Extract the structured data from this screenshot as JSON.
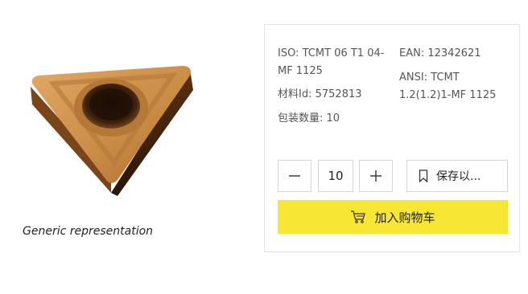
{
  "product": {
    "image_alt_icon": "triangular-insert-image",
    "caption": "Generic representation"
  },
  "specs": {
    "iso_label": "ISO:",
    "iso_value": "TCMT 06 T1 04-MF 1125",
    "material_label": "材料Id:",
    "material_value": "5752813",
    "pack_label": "包装数量:",
    "pack_value": "10",
    "ean_label": "EAN:",
    "ean_value": "12342621",
    "ansi_label": "ANSI:",
    "ansi_value": "TCMT 1.2(1.2)1-MF 1125"
  },
  "controls": {
    "quantity": "10",
    "save_label": "保存以...",
    "cart_label": "加入购物车",
    "minus_icon": "minus-icon",
    "plus_icon": "plus-icon",
    "bookmark_icon": "bookmark-icon",
    "cart_icon": "cart-icon"
  },
  "colors": {
    "cart_button": "#f8e635",
    "insert_body": "#c8853f"
  }
}
